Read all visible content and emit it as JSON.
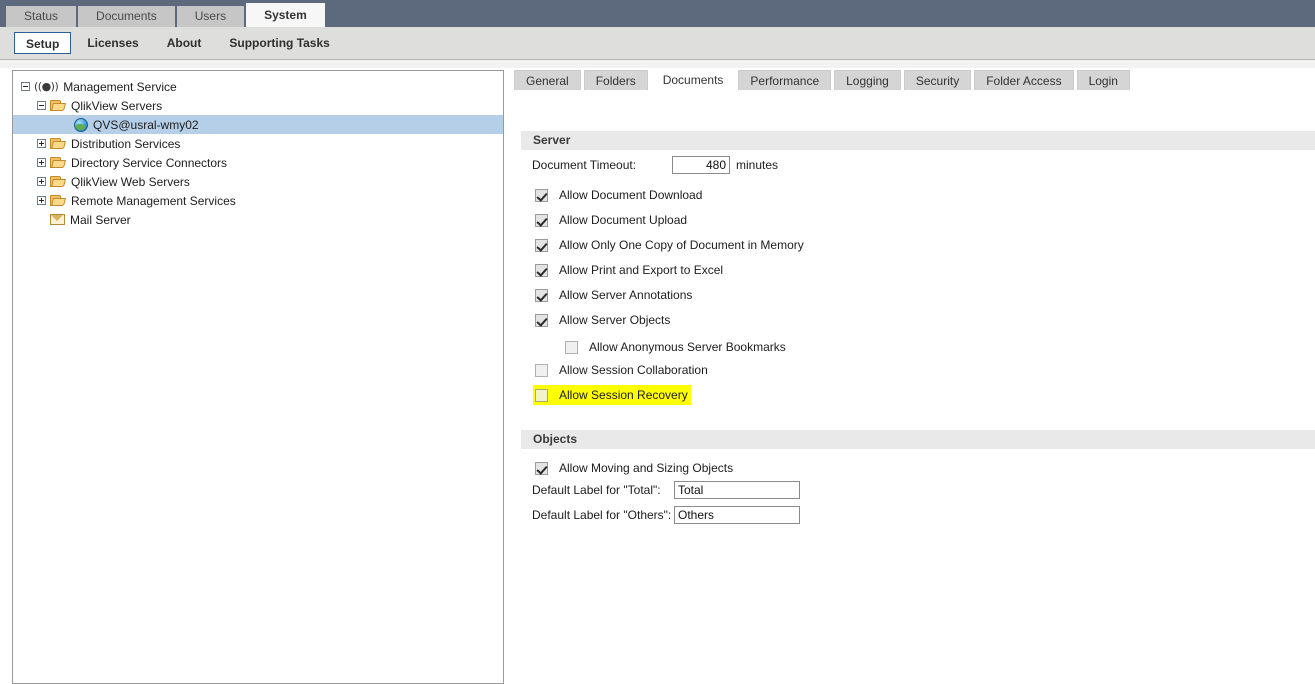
{
  "topbar": {
    "tabs": [
      {
        "label": "Status",
        "active": false
      },
      {
        "label": "Documents",
        "active": false
      },
      {
        "label": "Users",
        "active": false
      },
      {
        "label": "System",
        "active": true
      }
    ]
  },
  "subnav": {
    "items": [
      {
        "label": "Setup",
        "active": true
      },
      {
        "label": "Licenses",
        "active": false
      },
      {
        "label": "About",
        "active": false
      },
      {
        "label": "Supporting Tasks",
        "active": false
      }
    ]
  },
  "tree": {
    "nodes": [
      {
        "label": "Management Service",
        "icon": "antenna-icon",
        "toggle": "minus",
        "indent": 0,
        "selected": false
      },
      {
        "label": "QlikView Servers",
        "icon": "folder-icon",
        "toggle": "minus",
        "indent": 1,
        "selected": false
      },
      {
        "label": "QVS@usral-wmy02",
        "icon": "globe-icon",
        "toggle": "none",
        "indent": 2,
        "selected": true
      },
      {
        "label": "Distribution Services",
        "icon": "folder-icon",
        "toggle": "plus",
        "indent": 1,
        "selected": false
      },
      {
        "label": "Directory Service Connectors",
        "icon": "folder-icon",
        "toggle": "plus",
        "indent": 1,
        "selected": false
      },
      {
        "label": "QlikView Web Servers",
        "icon": "folder-icon",
        "toggle": "plus",
        "indent": 1,
        "selected": false
      },
      {
        "label": "Remote Management Services",
        "icon": "folder-icon",
        "toggle": "plus",
        "indent": 1,
        "selected": false
      },
      {
        "label": "Mail Server",
        "icon": "envelope-icon",
        "toggle": "none",
        "indent": 1,
        "selected": false
      }
    ]
  },
  "content": {
    "tabs": [
      {
        "label": "General",
        "active": false
      },
      {
        "label": "Folders",
        "active": false
      },
      {
        "label": "Documents",
        "active": true
      },
      {
        "label": "Performance",
        "active": false
      },
      {
        "label": "Logging",
        "active": false
      },
      {
        "label": "Security",
        "active": false
      },
      {
        "label": "Folder Access",
        "active": false
      },
      {
        "label": "Login",
        "active": false
      }
    ],
    "server": {
      "heading": "Server",
      "timeout_label": "Document Timeout:",
      "timeout_value": "480",
      "timeout_unit": "minutes",
      "checkboxes": [
        {
          "label": "Allow Document Download",
          "checked": true,
          "indent": 0,
          "highlight": false
        },
        {
          "label": "Allow Document Upload",
          "checked": true,
          "indent": 0,
          "highlight": false
        },
        {
          "label": "Allow Only One Copy of Document in Memory",
          "checked": true,
          "indent": 0,
          "highlight": false
        },
        {
          "label": "Allow Print and Export to Excel",
          "checked": true,
          "indent": 0,
          "highlight": false
        },
        {
          "label": "Allow Server Annotations",
          "checked": true,
          "indent": 0,
          "highlight": false
        },
        {
          "label": "Allow Server Objects",
          "checked": true,
          "indent": 0,
          "highlight": false
        },
        {
          "label": "Allow Anonymous Server Bookmarks",
          "checked": false,
          "indent": 1,
          "highlight": false
        },
        {
          "label": "Allow Session Collaboration",
          "checked": false,
          "indent": 0,
          "highlight": false
        },
        {
          "label": "Allow Session Recovery",
          "checked": false,
          "indent": 0,
          "highlight": true
        }
      ]
    },
    "objects": {
      "heading": "Objects",
      "moving_label": "Allow Moving and Sizing Objects",
      "moving_checked": true,
      "total_label": "Default Label for \"Total\":",
      "total_value": "Total",
      "others_label": "Default Label for \"Others\":",
      "others_value": "Others"
    }
  },
  "colors": {
    "header_bar": "#5d6a7d",
    "tab_inactive": "#c6c6c6",
    "tree_selection": "#b6cfe9",
    "highlight": "#ffff00",
    "section_head": "#e9e9e9",
    "accent_border": "#2f5d96"
  }
}
